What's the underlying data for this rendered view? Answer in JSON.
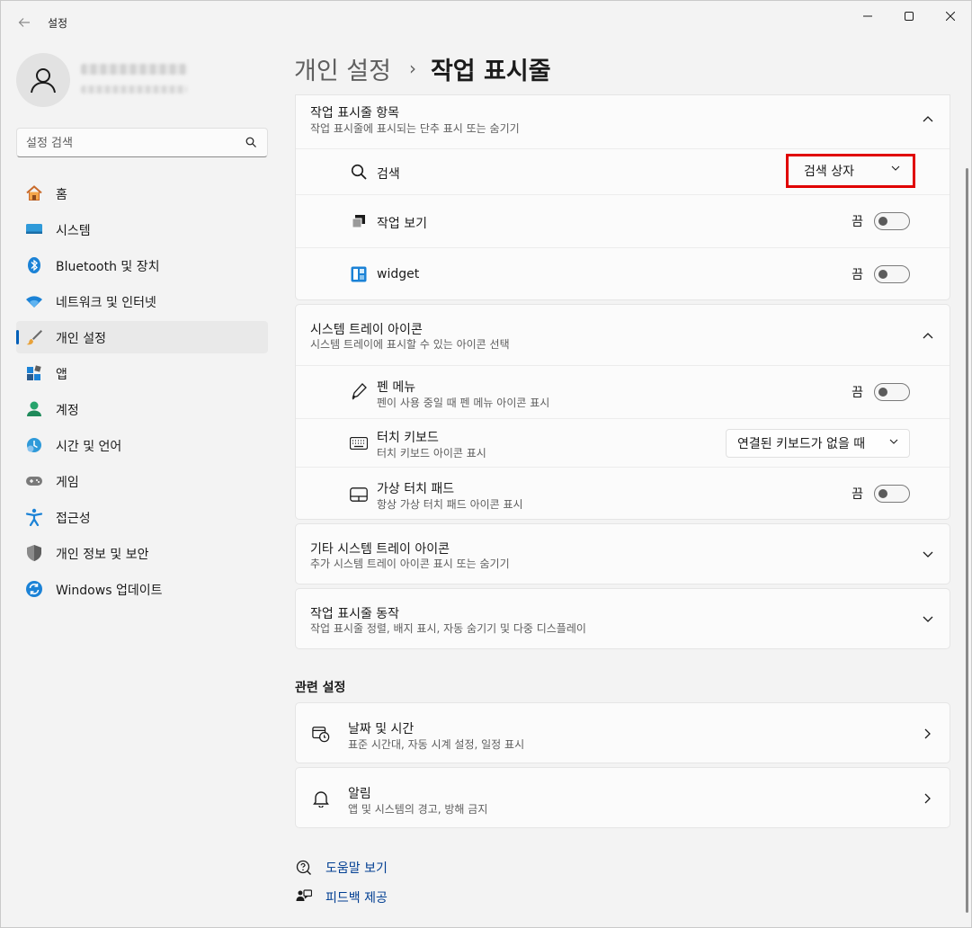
{
  "window": {
    "app_title": "설정",
    "controls": {
      "minimize": "minimize-icon",
      "maximize": "maximize-icon",
      "close": "close-icon"
    }
  },
  "sidebar": {
    "search_placeholder": "설정 검색",
    "items": [
      {
        "label": "홈",
        "icon": "home-icon",
        "active": false
      },
      {
        "label": "시스템",
        "icon": "system-icon",
        "active": false
      },
      {
        "label": "Bluetooth 및 장치",
        "icon": "bluetooth-icon",
        "active": false
      },
      {
        "label": "네트워크 및 인터넷",
        "icon": "wifi-icon",
        "active": false
      },
      {
        "label": "개인 설정",
        "icon": "brush-icon",
        "active": true
      },
      {
        "label": "앱",
        "icon": "apps-icon",
        "active": false
      },
      {
        "label": "계정",
        "icon": "account-icon",
        "active": false
      },
      {
        "label": "시간 및 언어",
        "icon": "time-language-icon",
        "active": false
      },
      {
        "label": "게임",
        "icon": "gamepad-icon",
        "active": false
      },
      {
        "label": "접근성",
        "icon": "accessibility-icon",
        "active": false
      },
      {
        "label": "개인 정보 및 보안",
        "icon": "shield-icon",
        "active": false
      },
      {
        "label": "Windows 업데이트",
        "icon": "update-icon",
        "active": false
      }
    ]
  },
  "breadcrumb": {
    "parent": "개인 설정",
    "separator": "›",
    "current": "작업 표시줄"
  },
  "sections": {
    "taskbar_items": {
      "title": "작업 표시줄 항목",
      "subtitle": "작업 표시줄에 표시되는 단추 표시 또는 숨기기",
      "rows": {
        "search": {
          "label": "검색",
          "value": "검색 상자"
        },
        "task_view": {
          "label": "작업 보기",
          "state": "끔"
        },
        "widget": {
          "label": "widget",
          "state": "끔"
        }
      }
    },
    "system_tray": {
      "title": "시스템 트레이 아이콘",
      "subtitle": "시스템 트레이에 표시할 수 있는 아이콘 선택",
      "rows": {
        "pen_menu": {
          "label": "펜 메뉴",
          "sub": "펜이 사용 중일 때 펜 메뉴 아이콘 표시",
          "state": "끔"
        },
        "touch_keyboard": {
          "label": "터치 키보드",
          "sub": "터치 키보드 아이콘 표시",
          "value": "연결된 키보드가 없을 때"
        },
        "virtual_touchpad": {
          "label": "가상 터치 패드",
          "sub": "항상 가상 터치 패드 아이콘 표시",
          "state": "끔"
        }
      }
    },
    "other_tray": {
      "title": "기타 시스템 트레이 아이콘",
      "subtitle": "추가 시스템 트레이 아이콘 표시 또는 숨기기"
    },
    "behaviors": {
      "title": "작업 표시줄 동작",
      "subtitle": "작업 표시줄 정렬, 배지 표시, 자동 숨기기 및 다중 디스플레이"
    }
  },
  "related": {
    "title": "관련 설정",
    "date_time": {
      "label": "날짜 및 시간",
      "sub": "표준 시간대, 자동 시계 설정, 일정 표시"
    },
    "notifications": {
      "label": "알림",
      "sub": "앱 및 시스템의 경고, 방해 금지"
    }
  },
  "help": {
    "get_help": "도움말 보기",
    "feedback": "피드백 제공"
  },
  "colors": {
    "accent": "#005fb8",
    "highlight": "#e00000",
    "link": "#003e92"
  }
}
